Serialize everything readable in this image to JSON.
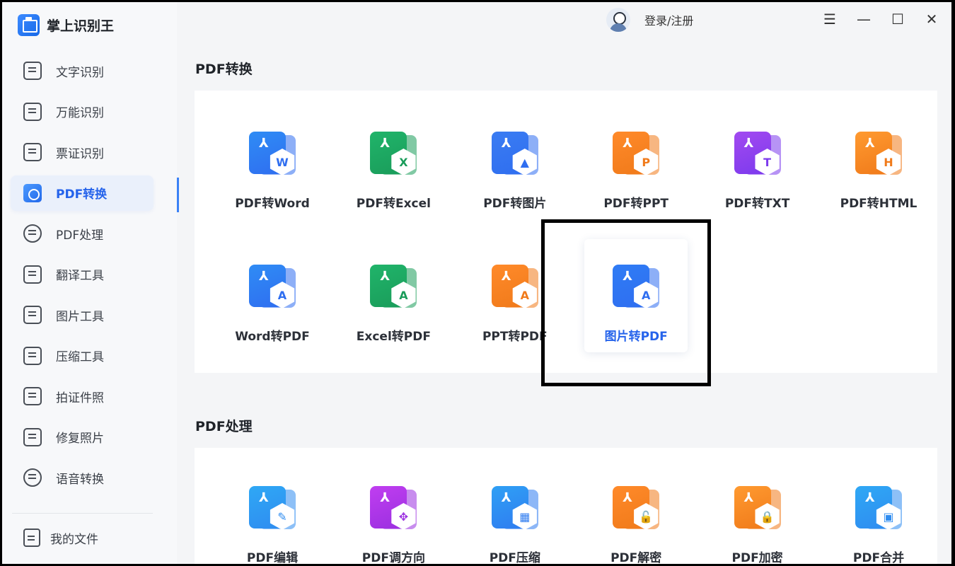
{
  "app": {
    "name": "掌上识别王"
  },
  "header": {
    "login_label": "登录/注册",
    "menu_glyph": "☰",
    "min_glyph": "—",
    "max_glyph": "☐",
    "close_glyph": "✕"
  },
  "sidebar": {
    "items": [
      {
        "label": "文字识别",
        "icon": "text-recognition-icon"
      },
      {
        "label": "万能识别",
        "icon": "universal-recognition-icon"
      },
      {
        "label": "票证识别",
        "icon": "ticket-recognition-icon"
      },
      {
        "label": "PDF转换",
        "icon": "pdf-convert-icon",
        "active": true
      },
      {
        "label": "PDF处理",
        "icon": "pdf-process-icon"
      },
      {
        "label": "翻译工具",
        "icon": "translate-icon"
      },
      {
        "label": "图片工具",
        "icon": "image-tools-icon"
      },
      {
        "label": "压缩工具",
        "icon": "compress-icon"
      },
      {
        "label": "拍证件照",
        "icon": "id-photo-icon"
      },
      {
        "label": "修复照片",
        "icon": "photo-repair-icon"
      },
      {
        "label": "语音转换",
        "icon": "voice-convert-icon"
      }
    ],
    "my_files": "我的文件"
  },
  "sections": {
    "convert": {
      "title": "PDF转换",
      "tiles": [
        {
          "label": "PDF转Word",
          "badge": "W",
          "color": "#2f8cf5",
          "badge_color": "#2f6ef0"
        },
        {
          "label": "PDF转Excel",
          "badge": "X",
          "color": "#20b46a",
          "badge_color": "#1a9c5a"
        },
        {
          "label": "PDF转图片",
          "badge": "▲",
          "color": "#3a7cf2",
          "badge_color": "#2f6ef0"
        },
        {
          "label": "PDF转PPT",
          "badge": "P",
          "color": "#ff8a2a",
          "badge_color": "#f07a1a"
        },
        {
          "label": "PDF转TXT",
          "badge": "T",
          "color": "#a24af0",
          "badge_color": "#7c3aed"
        },
        {
          "label": "PDF转HTML",
          "badge": "H",
          "color": "#ff9a30",
          "badge_color": "#f07a1a"
        },
        {
          "label": "Word转PDF",
          "badge": "A",
          "color": "#2f8cf5",
          "badge_color": "#2f6ef0"
        },
        {
          "label": "Excel转PDF",
          "badge": "A",
          "color": "#20b46a",
          "badge_color": "#1a9c5a"
        },
        {
          "label": "PPT转PDF",
          "badge": "A",
          "color": "#ff8a2a",
          "badge_color": "#f07a1a"
        },
        {
          "label": "图片转PDF",
          "badge": "A",
          "color": "#2f7cf5",
          "badge_color": "#2f6ef0",
          "selected": true
        }
      ]
    },
    "process": {
      "title": "PDF处理",
      "tiles": [
        {
          "label": "PDF编辑",
          "badge": "✎",
          "color": "#2fa8f5",
          "badge_color": "#2f8cf0"
        },
        {
          "label": "PDF调方向",
          "badge": "✥",
          "color": "#c03ef0",
          "badge_color": "#9b2fe0"
        },
        {
          "label": "PDF压缩",
          "badge": "▦",
          "color": "#2fa0f5",
          "badge_color": "#2f7cf0"
        },
        {
          "label": "PDF解密",
          "badge": "🔓",
          "color": "#ff8a2a",
          "badge_color": "#f07a1a"
        },
        {
          "label": "PDF加密",
          "badge": "🔒",
          "color": "#ff9a30",
          "badge_color": "#f07a1a"
        },
        {
          "label": "PDF合并",
          "badge": "▣",
          "color": "#2fa8f5",
          "badge_color": "#2f8cf0"
        }
      ]
    }
  }
}
